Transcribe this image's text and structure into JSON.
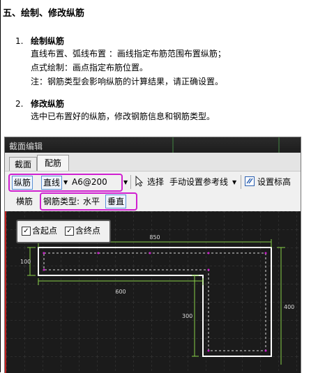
{
  "doc": {
    "heading": "五、绘制、修改纵筋",
    "items": [
      {
        "num": "1.",
        "title": "绘制纵筋",
        "lines": [
          "直线布置、弧线布置 ：画线指定布筋范围布置纵筋；",
          "点式绘制：画点指定布筋位置。",
          "注：钢筋类型会影响纵筋的计算结果，请正确设置。"
        ]
      },
      {
        "num": "2.",
        "title": "修改纵筋",
        "lines": [
          "选中已布置好的纵筋，修改钢筋信息和钢筋类型。"
        ]
      }
    ]
  },
  "window": {
    "title": "截面编辑",
    "tabs": [
      "截面",
      "配筋"
    ],
    "toolbar": {
      "rebar_button": "纵筋",
      "mode_select": "直线",
      "rebar_spec": "A6@200",
      "select_label": "选择",
      "ref_line_label": "手动设置参考线",
      "set_elev_label": "设置标高"
    },
    "toolbar2": {
      "stirrup_label": "横筋",
      "rebar_type_label": "钢筋类型:",
      "horizontal_label": "水平",
      "vertical_label": "垂直"
    },
    "options": {
      "include_start": "含起点",
      "include_end": "含终点"
    },
    "dimensions": {
      "top_width": "850",
      "left_height": "100",
      "mid_width": "600",
      "leg_height": "300",
      "right_height": "400"
    }
  },
  "colors": {
    "accent_highlight": "#d020d0",
    "canvas_bg": "#1b1b1b",
    "dimension": "#8ad04a"
  }
}
